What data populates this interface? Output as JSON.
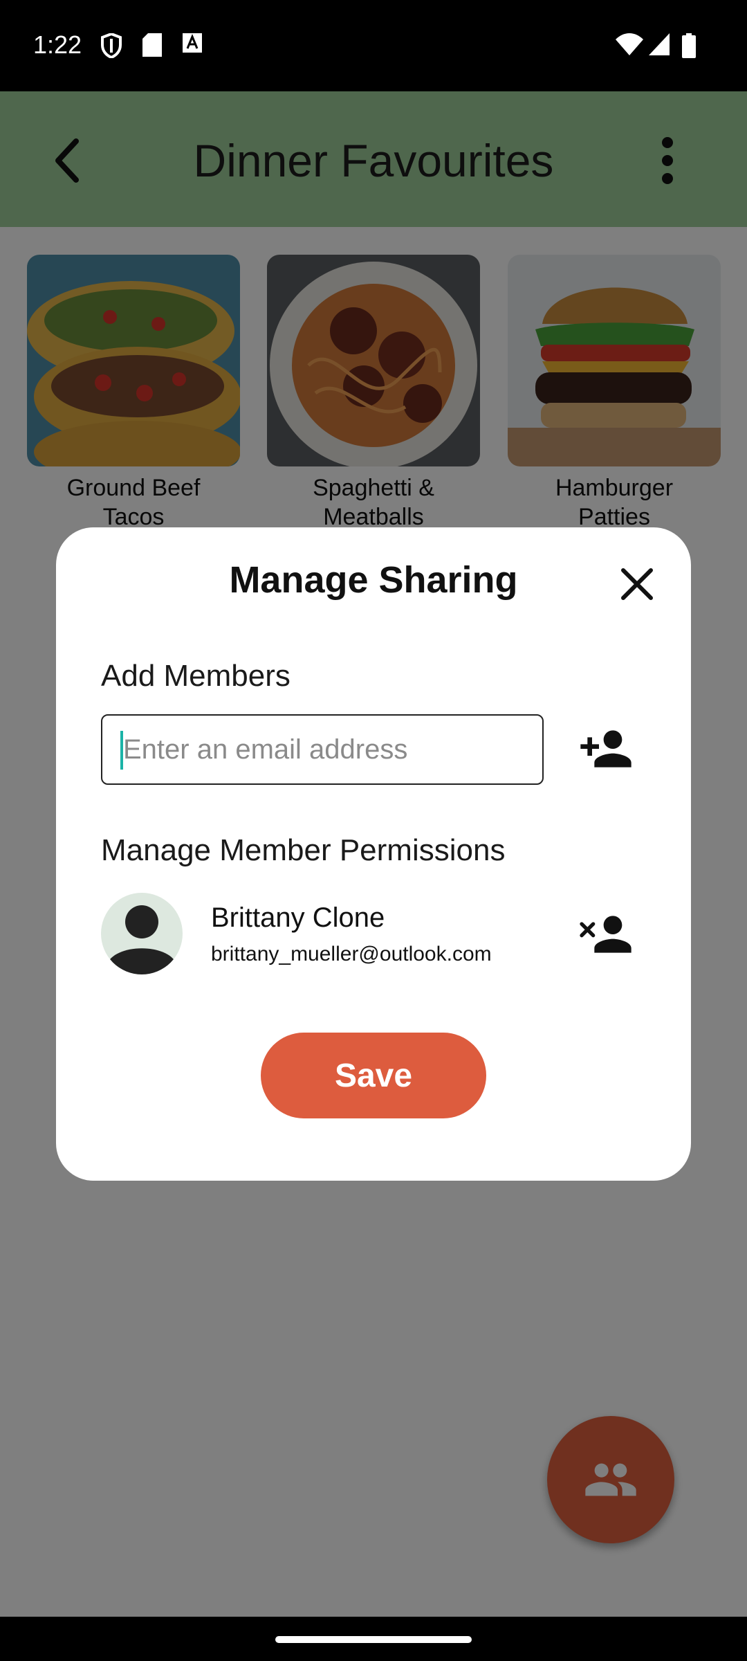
{
  "status_bar": {
    "time": "1:22"
  },
  "app_bar": {
    "title": "Dinner Favourites"
  },
  "recipes": [
    {
      "name_line1": "Ground Beef",
      "name_line2": "Tacos"
    },
    {
      "name_line1": "Spaghetti &",
      "name_line2": "Meatballs"
    },
    {
      "name_line1": "Hamburger",
      "name_line2": "Patties"
    }
  ],
  "dialog": {
    "title": "Manage Sharing",
    "add_members_label": "Add Members",
    "email_placeholder": "Enter an email address",
    "email_value": "",
    "permissions_label": "Manage Member Permissions",
    "members": [
      {
        "name": "Brittany Clone",
        "email": "brittany_mueller@outlook.com"
      }
    ],
    "save_label": "Save"
  },
  "colors": {
    "app_bar": "#9fcf9a",
    "accent": "#dd5c3e",
    "caret": "#1bb3a7"
  }
}
